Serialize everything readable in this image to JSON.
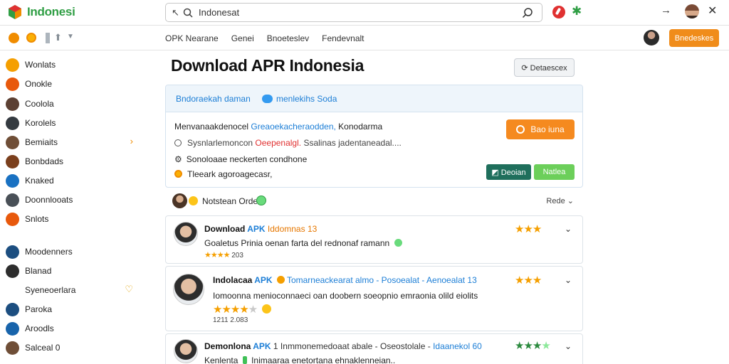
{
  "app": {
    "brand": "Indonesi",
    "brand_color": "#2f9e44",
    "accent": "#f08c1a"
  },
  "search": {
    "value": "Indonesat",
    "left_glyph": "↖"
  },
  "topbar": {
    "arrow_glyph": "→",
    "close_glyph": "✕"
  },
  "navbar": {
    "tabs": [
      "OPK Nearane",
      "Genei",
      "Bnoeteslev",
      "Fendevnalt"
    ],
    "button": "Bnedeskes"
  },
  "sidebar": {
    "items": [
      {
        "label": "Wonlats",
        "color": "#f59f00",
        "right": ""
      },
      {
        "label": "Onokle",
        "color": "#e8590c",
        "right": ""
      },
      {
        "label": "Coolola",
        "color": "#5c4033",
        "right": ""
      },
      {
        "label": "Korolels",
        "color": "#343a40",
        "right": ""
      },
      {
        "label": "Bemiaits",
        "color": "#6f4e37",
        "right": "›"
      },
      {
        "label": "Bonbdads",
        "color": "#7b3f1d",
        "right": ""
      },
      {
        "label": "Knaked",
        "color": "#1971c2",
        "right": ""
      },
      {
        "label": "Doonnlooats",
        "color": "#495057",
        "right": ""
      },
      {
        "label": "Snlots",
        "color": "#e8590c",
        "right": ""
      },
      {
        "label": "Moodenners",
        "color": "#1c4e80",
        "right": ""
      },
      {
        "label": "Blanad",
        "color": "#2d2d2d",
        "right": ""
      },
      {
        "label": "Syeneoerlara",
        "color": "",
        "right": "♡"
      },
      {
        "label": "Paroka",
        "color": "#1c4e80",
        "right": ""
      },
      {
        "label": "Aroodls",
        "color": "#1864ab",
        "right": ""
      },
      {
        "label": "Salceal 0",
        "color": "#6f4e37",
        "right": ""
      }
    ]
  },
  "main": {
    "title": "Download APR Indonesia",
    "title_button": "Detaescex"
  },
  "card": {
    "head_text1": "Bndoraekah  daman",
    "head_text2": "menlekihs  Soda",
    "line1_a": "Menvanaakdenocel",
    "line1_b": "Greaoekacheraodden,",
    "line1_c": " Konodarma",
    "line2_a": "Sysnlarlemoncon",
    "line2_b": "Oeepenalgl.",
    "line2_c": "  Ssalinas  jadentaneadal....",
    "line3": "Sonoloaae  neckerten  condhone",
    "line4": "Tleeark  agoroagecasr,",
    "btn_orange": "Bao iuna",
    "btn_dark": "Deoian",
    "btn_green": "Natlea"
  },
  "reviews_header": {
    "text": "Notstean Ordes",
    "sort": "Rede"
  },
  "reviews": [
    {
      "name": "Download",
      "apk": "APK",
      "meta": "Iddomnas 13",
      "body": "Goaletus  Prinia  oenan  farta  del  rednonaf  ramann",
      "sub": "203",
      "stars": 3
    },
    {
      "name": "Indolacaa",
      "apk": "APK",
      "meta": "Tomarneackearat almo -  Posoealat  -  Aenoealat  13",
      "body": "Iomoonna  menioconnaeci  oan  doobern  soeopnio  emraonia  olild  eiolits",
      "sub": "1211 2.083",
      "stars": 3
    },
    {
      "name": "Demonlona",
      "apk": "APK",
      "meta": "1  Inmmonemedoaat abale  -  Oseostolale  -",
      "meta2": "Idaanekol 60",
      "body": "Kenlenta",
      "body2": "Inimaaraa  enetortana  ehnaklenneian..",
      "stars": 4
    }
  ]
}
